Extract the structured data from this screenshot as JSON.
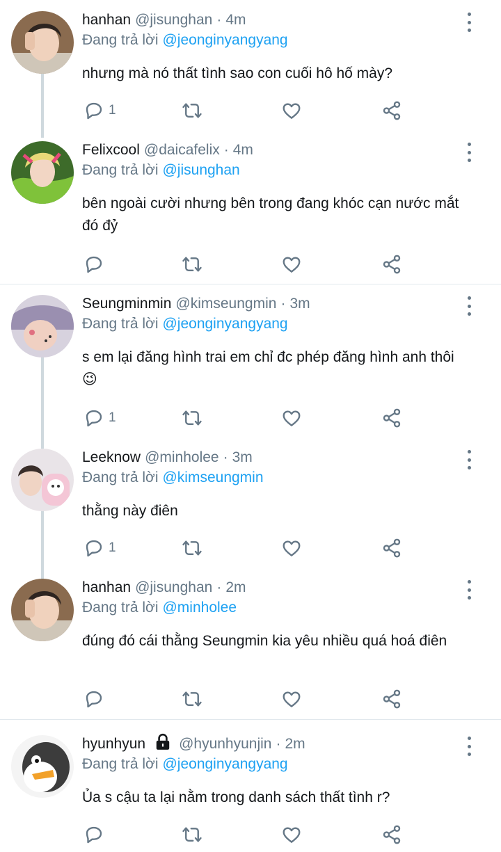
{
  "reply_prefix": "Đang trả lời",
  "tweets": [
    {
      "name": "hanhan",
      "handle": "@jisunghan",
      "time": "4m",
      "reply_to": "@jeonginyangyang",
      "text": "nhưng mà nó thất tình sao con cuối hô hố mày?",
      "reply_count": "1",
      "avatar_icon": "boy-avatar"
    },
    {
      "name": "Felixcool",
      "handle": "@daicafelix",
      "time": "4m",
      "reply_to": "@jisunghan",
      "text": "bên ngoài cười nhưng bên trong đang khóc cạn nước mắt đó đỷ",
      "reply_count": "",
      "avatar_icon": "felix-avatar"
    },
    {
      "name": "Seungminmin",
      "handle": "@kimseungmin",
      "time": "3m",
      "reply_to": "@jeonginyangyang",
      "text": "s em lại đăng hình trai em chỉ đc phép đăng hình anh thôi 😉",
      "reply_count": "1",
      "avatar_icon": "hat-avatar"
    },
    {
      "name": "Leeknow",
      "handle": "@minholee",
      "time": "3m",
      "reply_to": "@kimseungmin",
      "text": "thằng này điên",
      "reply_count": "1",
      "avatar_icon": "cat-backpack-avatar"
    },
    {
      "name": "hanhan",
      "handle": "@jisunghan",
      "time": "2m",
      "reply_to": "@minholee",
      "text": "đúng đó cái thằng Seungmin kia yêu nhiều quá hoá điên",
      "reply_count": "",
      "avatar_icon": "boy-avatar"
    },
    {
      "name": "hyunhyun",
      "handle": "@hyunhyunjin",
      "time": "2m",
      "reply_to": "@jeonginyangyang",
      "text": "Ủa s cậu ta lại nằm trong danh sách thất tình r?",
      "reply_count": "",
      "avatar_icon": "penguin-avatar",
      "locked": true
    }
  ],
  "colors": {
    "link": "#1da1f2",
    "muted": "#657786",
    "text": "#14171a",
    "thread_line": "#cfd9de",
    "divider": "#e1e8ed"
  }
}
